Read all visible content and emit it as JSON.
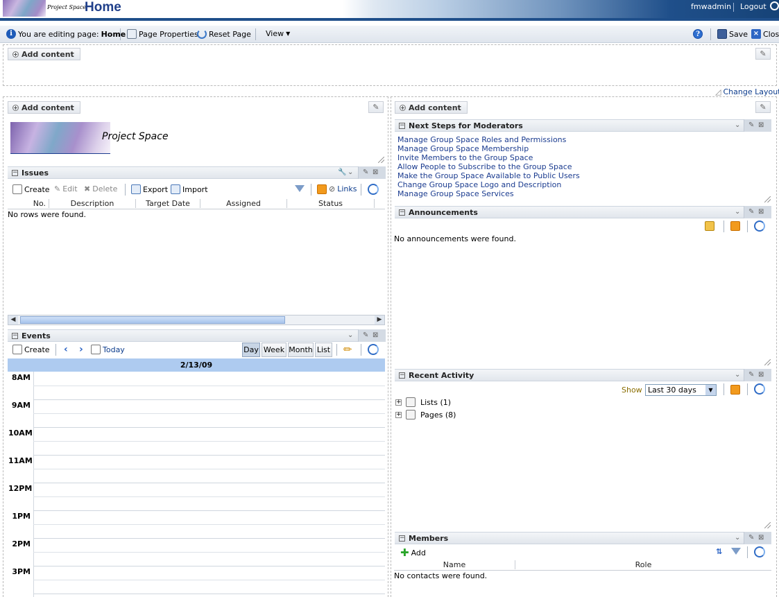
{
  "banner": {
    "logo_text": "Project Space",
    "page_title": "Home",
    "user": "fmwadmin",
    "logout": "Logout"
  },
  "edit_toolbar": {
    "editing_prefix": "You are editing page:",
    "editing_page": "Home",
    "page_properties": "Page Properties",
    "reset_page": "Reset Page",
    "view": "View",
    "save": "Save",
    "close": "Close"
  },
  "layout": {
    "add_content": "Add content",
    "change_layout": "Change Layout"
  },
  "project_space": {
    "title": "Project Space"
  },
  "issues": {
    "title": "Issues",
    "create": "Create",
    "edit": "Edit",
    "delete": "Delete",
    "export": "Export",
    "import": "Import",
    "links": "Links",
    "columns": [
      "No.",
      "Description",
      "Target Date",
      "Assigned",
      "Status"
    ],
    "empty": "No rows were found."
  },
  "events": {
    "title": "Events",
    "create": "Create",
    "today": "Today",
    "views": [
      "Day",
      "Week",
      "Month",
      "List"
    ],
    "selected_view": "Day",
    "date": "2/13/09",
    "hours": [
      "8AM",
      "9AM",
      "10AM",
      "11AM",
      "12PM",
      "1PM",
      "2PM",
      "3PM"
    ]
  },
  "next_steps": {
    "title": "Next Steps for Moderators",
    "links": [
      "Manage Group Space Roles and Permissions",
      "Manage Group Space Membership",
      "Invite Members to the Group Space",
      "Allow People to Subscribe to the Group Space",
      "Make the Group Space Available to Public Users",
      "Change Group Space Logo and Description",
      "Manage Group Space Services"
    ]
  },
  "announcements": {
    "title": "Announcements",
    "empty": "No announcements were found."
  },
  "recent_activity": {
    "title": "Recent Activity",
    "show_label": "Show",
    "show_value": "Last 30 days",
    "items": [
      "Lists (1)",
      "Pages (8)"
    ]
  },
  "members": {
    "title": "Members",
    "add": "Add",
    "columns": [
      "Name",
      "Role"
    ],
    "empty": "No contacts were found."
  },
  "colors": {
    "banner_dark": "#1f4f8a",
    "link": "#1a3b8f",
    "calendar_header": "#aecbf0"
  }
}
